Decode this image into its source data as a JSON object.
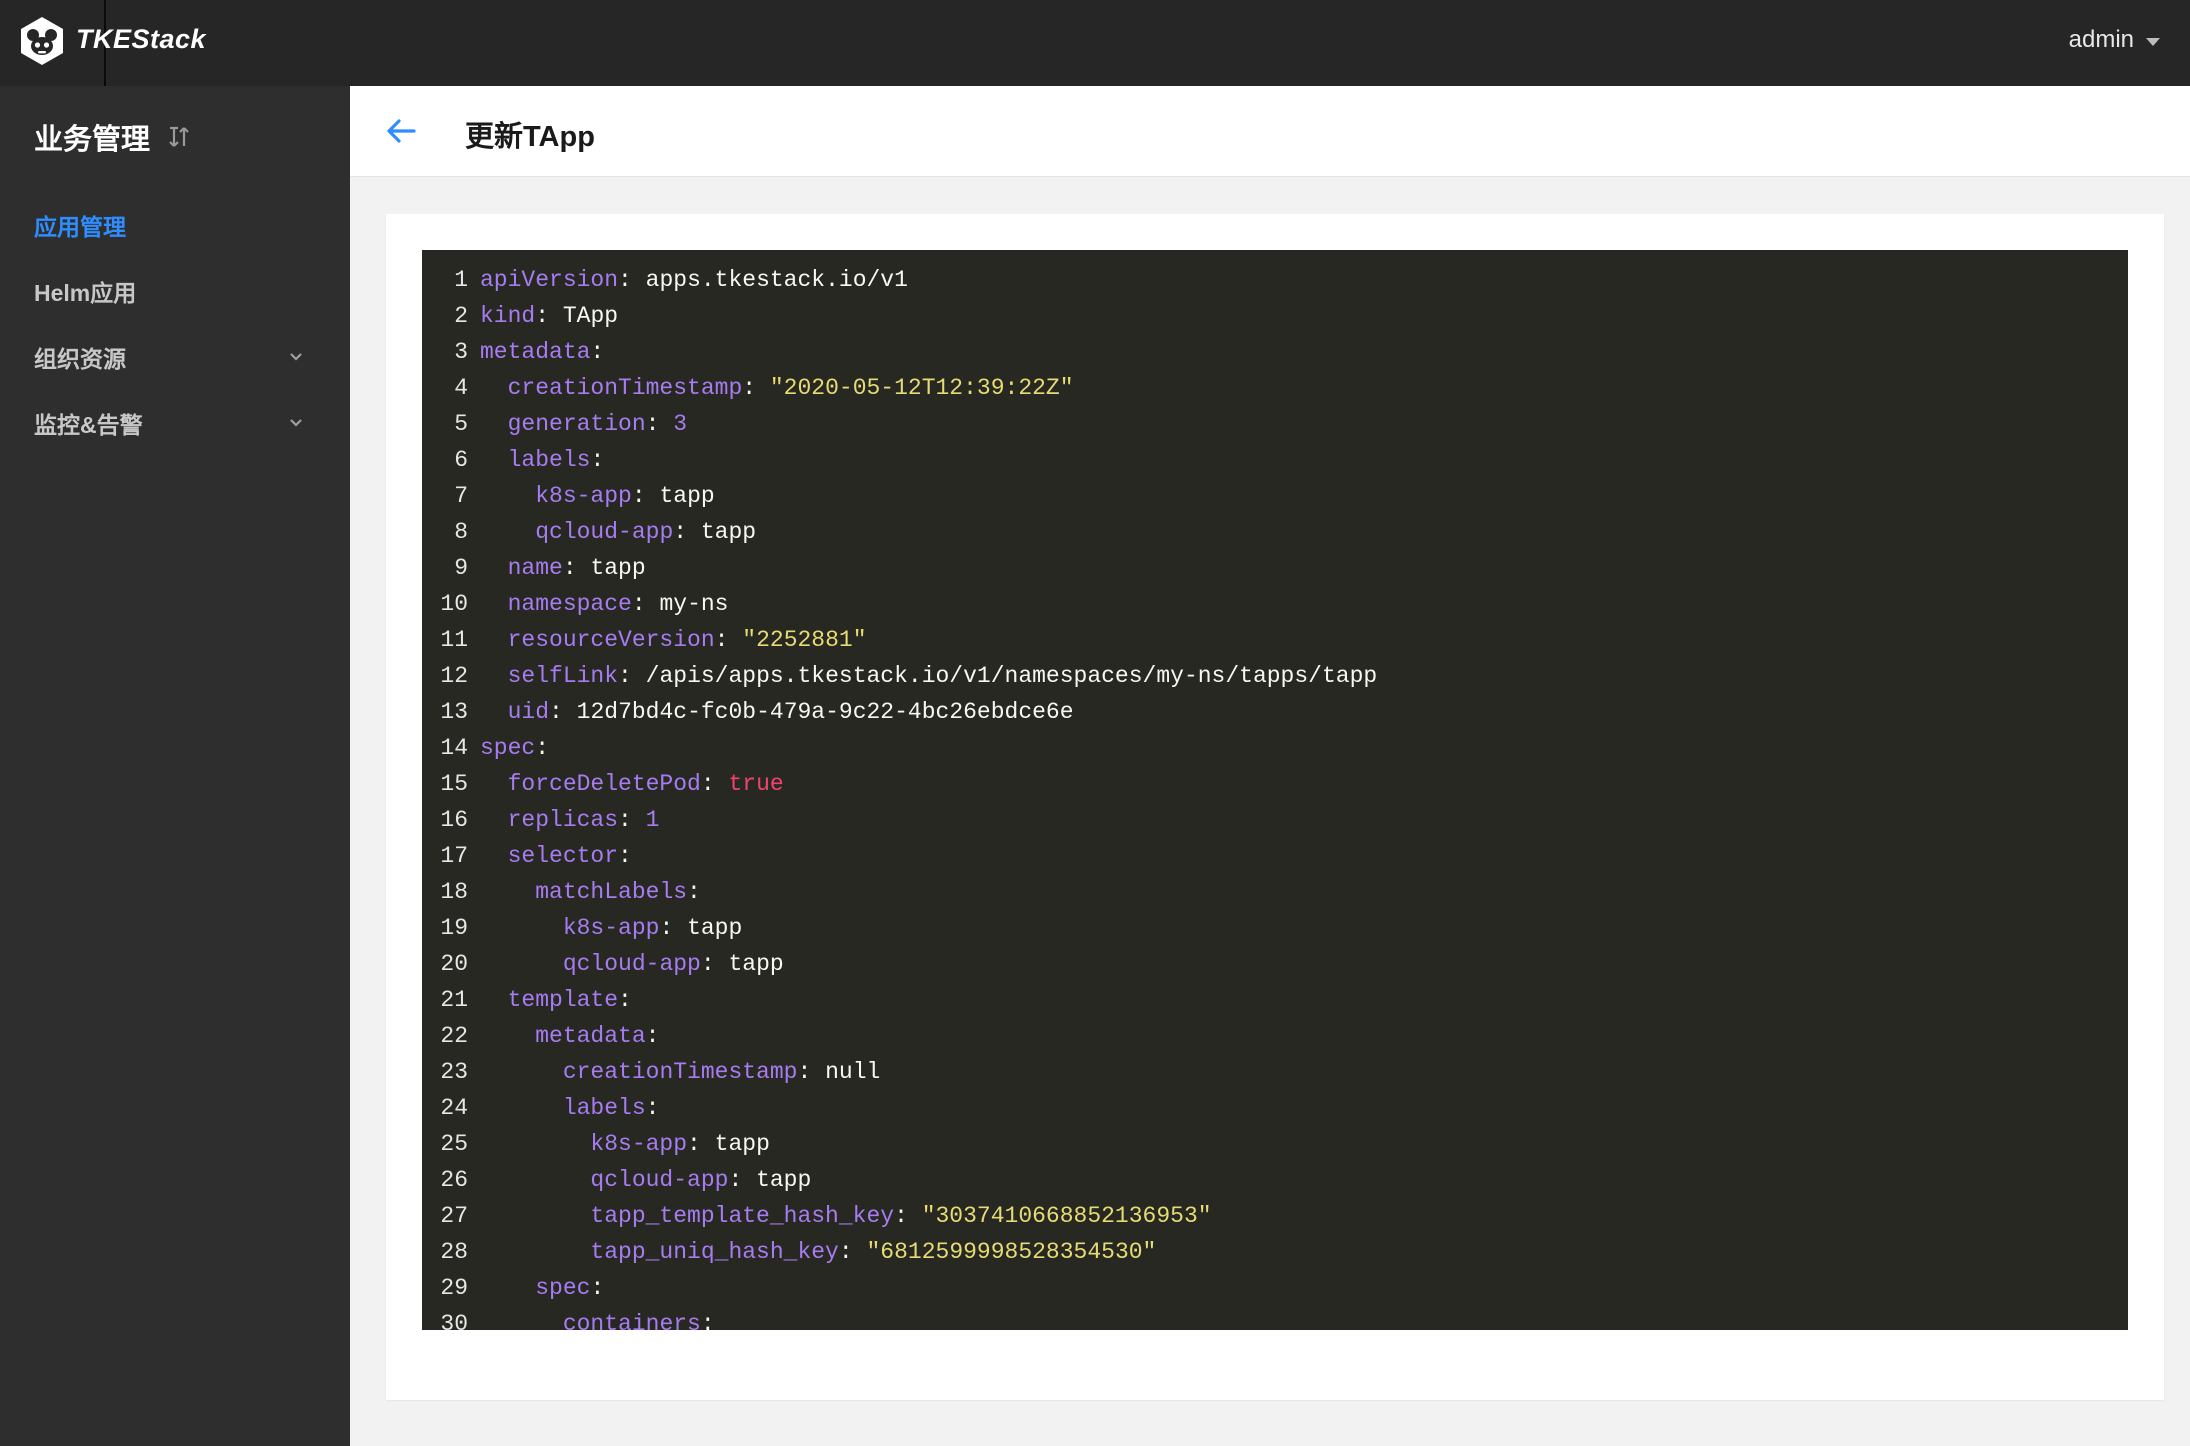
{
  "app": {
    "brand": "TKEStack",
    "user": "admin"
  },
  "sidebar": {
    "title": "业务管理",
    "items": [
      {
        "label": "应用管理",
        "active": true,
        "expandable": false
      },
      {
        "label": "Helm应用",
        "active": false,
        "expandable": false
      },
      {
        "label": "组织资源",
        "active": false,
        "expandable": true
      },
      {
        "label": "监控&告警",
        "active": false,
        "expandable": true
      }
    ]
  },
  "page": {
    "title": "更新TApp"
  },
  "editor": {
    "lines": [
      {
        "n": "1",
        "indent": 0,
        "key": "apiVersion",
        "value": "apps.tkestack.io/v1",
        "type": "plain"
      },
      {
        "n": "2",
        "indent": 0,
        "key": "kind",
        "value": "TApp",
        "type": "plain"
      },
      {
        "n": "3",
        "indent": 0,
        "key": "metadata",
        "value": "",
        "type": "none"
      },
      {
        "n": "4",
        "indent": 1,
        "key": "creationTimestamp",
        "value": "\"2020-05-12T12:39:22Z\"",
        "type": "string"
      },
      {
        "n": "5",
        "indent": 1,
        "key": "generation",
        "value": "3",
        "type": "number"
      },
      {
        "n": "6",
        "indent": 1,
        "key": "labels",
        "value": "",
        "type": "none"
      },
      {
        "n": "7",
        "indent": 2,
        "key": "k8s-app",
        "value": "tapp",
        "type": "plain"
      },
      {
        "n": "8",
        "indent": 2,
        "key": "qcloud-app",
        "value": "tapp",
        "type": "plain"
      },
      {
        "n": "9",
        "indent": 1,
        "key": "name",
        "value": "tapp",
        "type": "plain"
      },
      {
        "n": "10",
        "indent": 1,
        "key": "namespace",
        "value": "my-ns",
        "type": "plain"
      },
      {
        "n": "11",
        "indent": 1,
        "key": "resourceVersion",
        "value": "\"2252881\"",
        "type": "string"
      },
      {
        "n": "12",
        "indent": 1,
        "key": "selfLink",
        "value": "/apis/apps.tkestack.io/v1/namespaces/my-ns/tapps/tapp",
        "type": "plain"
      },
      {
        "n": "13",
        "indent": 1,
        "key": "uid",
        "value": "12d7bd4c-fc0b-479a-9c22-4bc26ebdce6e",
        "type": "plain"
      },
      {
        "n": "14",
        "indent": 0,
        "key": "spec",
        "value": "",
        "type": "none"
      },
      {
        "n": "15",
        "indent": 1,
        "key": "forceDeletePod",
        "value": "true",
        "type": "bool"
      },
      {
        "n": "16",
        "indent": 1,
        "key": "replicas",
        "value": "1",
        "type": "number"
      },
      {
        "n": "17",
        "indent": 1,
        "key": "selector",
        "value": "",
        "type": "none"
      },
      {
        "n": "18",
        "indent": 2,
        "key": "matchLabels",
        "value": "",
        "type": "none"
      },
      {
        "n": "19",
        "indent": 3,
        "key": "k8s-app",
        "value": "tapp",
        "type": "plain"
      },
      {
        "n": "20",
        "indent": 3,
        "key": "qcloud-app",
        "value": "tapp",
        "type": "plain"
      },
      {
        "n": "21",
        "indent": 1,
        "key": "template",
        "value": "",
        "type": "none"
      },
      {
        "n": "22",
        "indent": 2,
        "key": "metadata",
        "value": "",
        "type": "none"
      },
      {
        "n": "23",
        "indent": 3,
        "key": "creationTimestamp",
        "value": "null",
        "type": "plain"
      },
      {
        "n": "24",
        "indent": 3,
        "key": "labels",
        "value": "",
        "type": "none"
      },
      {
        "n": "25",
        "indent": 4,
        "key": "k8s-app",
        "value": "tapp",
        "type": "plain"
      },
      {
        "n": "26",
        "indent": 4,
        "key": "qcloud-app",
        "value": "tapp",
        "type": "plain"
      },
      {
        "n": "27",
        "indent": 4,
        "key": "tapp_template_hash_key",
        "value": "\"3037410668852136953\"",
        "type": "string"
      },
      {
        "n": "28",
        "indent": 4,
        "key": "tapp_uniq_hash_key",
        "value": "\"6812599998528354530\"",
        "type": "string"
      },
      {
        "n": "29",
        "indent": 2,
        "key": "spec",
        "value": "",
        "type": "none"
      },
      {
        "n": "30",
        "indent": 3,
        "key": "containers",
        "value": "",
        "type": "none"
      }
    ]
  },
  "colors": {
    "accent": "#2f8dff",
    "topbar": "#262626",
    "sidebar": "#2e2e2e",
    "editor_bg": "#272822",
    "yaml_key": "#a67cf0",
    "yaml_string": "#e6db74",
    "yaml_bool": "#f5426c"
  }
}
